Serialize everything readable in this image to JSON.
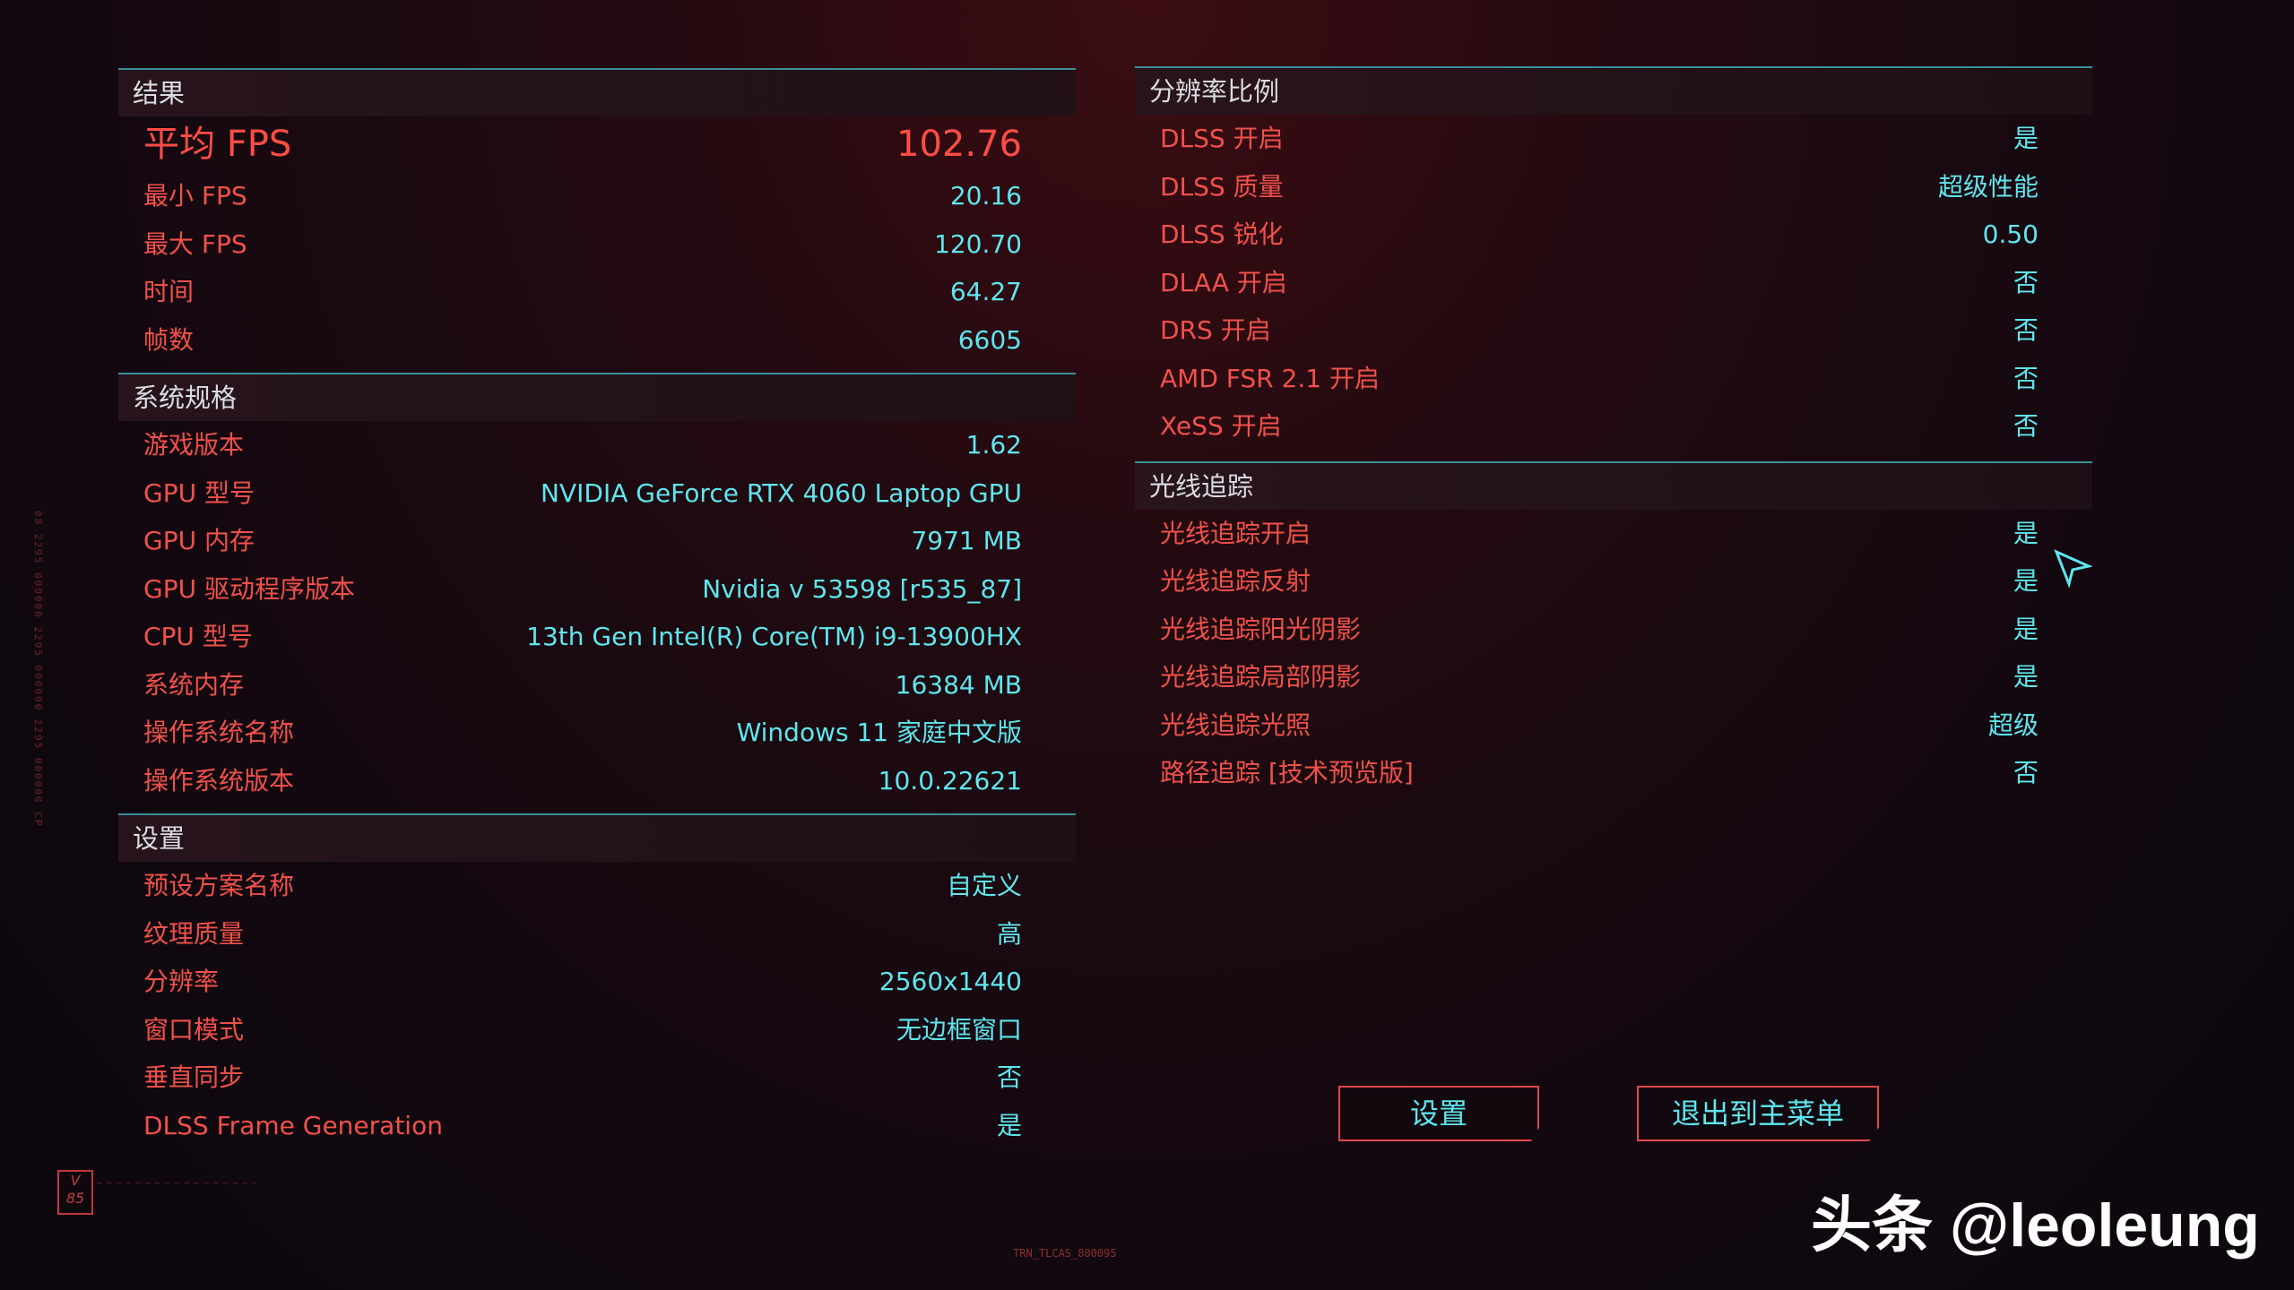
{
  "results": {
    "header": "结果",
    "avg_fps": {
      "label": "平均 FPS",
      "value": "102.76"
    },
    "rows": [
      {
        "label": "最小 FPS",
        "value": "20.16"
      },
      {
        "label": "最大 FPS",
        "value": "120.70"
      },
      {
        "label": "时间",
        "value": "64.27"
      },
      {
        "label": "帧数",
        "value": "6605"
      }
    ]
  },
  "system": {
    "header": "系统规格",
    "rows": [
      {
        "label": "游戏版本",
        "value": "1.62"
      },
      {
        "label": "GPU 型号",
        "value": "NVIDIA GeForce RTX 4060 Laptop GPU"
      },
      {
        "label": "GPU 内存",
        "value": "7971 MB"
      },
      {
        "label": "GPU 驱动程序版本",
        "value": "Nvidia v 53598 [r535_87]"
      },
      {
        "label": "CPU 型号",
        "value": "13th Gen Intel(R) Core(TM) i9-13900HX"
      },
      {
        "label": "系统内存",
        "value": "16384 MB"
      },
      {
        "label": "操作系统名称",
        "value": "Windows 11 家庭中文版"
      },
      {
        "label": "操作系统版本",
        "value": "10.0.22621"
      }
    ]
  },
  "settings": {
    "header": "设置",
    "rows": [
      {
        "label": "预设方案名称",
        "value": "自定义"
      },
      {
        "label": "纹理质量",
        "value": "高"
      },
      {
        "label": "分辨率",
        "value": "2560x1440"
      },
      {
        "label": "窗口模式",
        "value": "无边框窗口"
      },
      {
        "label": "垂直同步",
        "value": "否"
      },
      {
        "label": "DLSS Frame Generation",
        "value": "是"
      }
    ]
  },
  "resolution_scaling": {
    "header": "分辨率比例",
    "rows": [
      {
        "label": "DLSS 开启",
        "value": "是"
      },
      {
        "label": "DLSS 质量",
        "value": "超级性能"
      },
      {
        "label": "DLSS 锐化",
        "value": "0.50"
      },
      {
        "label": "DLAA 开启",
        "value": "否"
      },
      {
        "label": "DRS 开启",
        "value": "否"
      },
      {
        "label": "AMD FSR 2.1 开启",
        "value": "否"
      },
      {
        "label": "XeSS 开启",
        "value": "否"
      }
    ]
  },
  "ray_tracing": {
    "header": "光线追踪",
    "rows": [
      {
        "label": "光线追踪开启",
        "value": "是"
      },
      {
        "label": "光线追踪反射",
        "value": "是"
      },
      {
        "label": "光线追踪阳光阴影",
        "value": "是"
      },
      {
        "label": "光线追踪局部阴影",
        "value": "是"
      },
      {
        "label": "光线追踪光照",
        "value": "超级"
      },
      {
        "label": "路径追踪 [技术预览版]",
        "value": "否"
      }
    ]
  },
  "buttons": {
    "settings": "设置",
    "exit": "退出到主菜单"
  },
  "watermark": "头条 @leoleung",
  "corner_logo": "V 85",
  "bottom_tag": "TRN_TLCAS_800095",
  "colors": {
    "label": "#f0514a",
    "value": "#5fe6ee",
    "accent_line": "#3a8f9a",
    "highlight": "#ff4d45"
  }
}
